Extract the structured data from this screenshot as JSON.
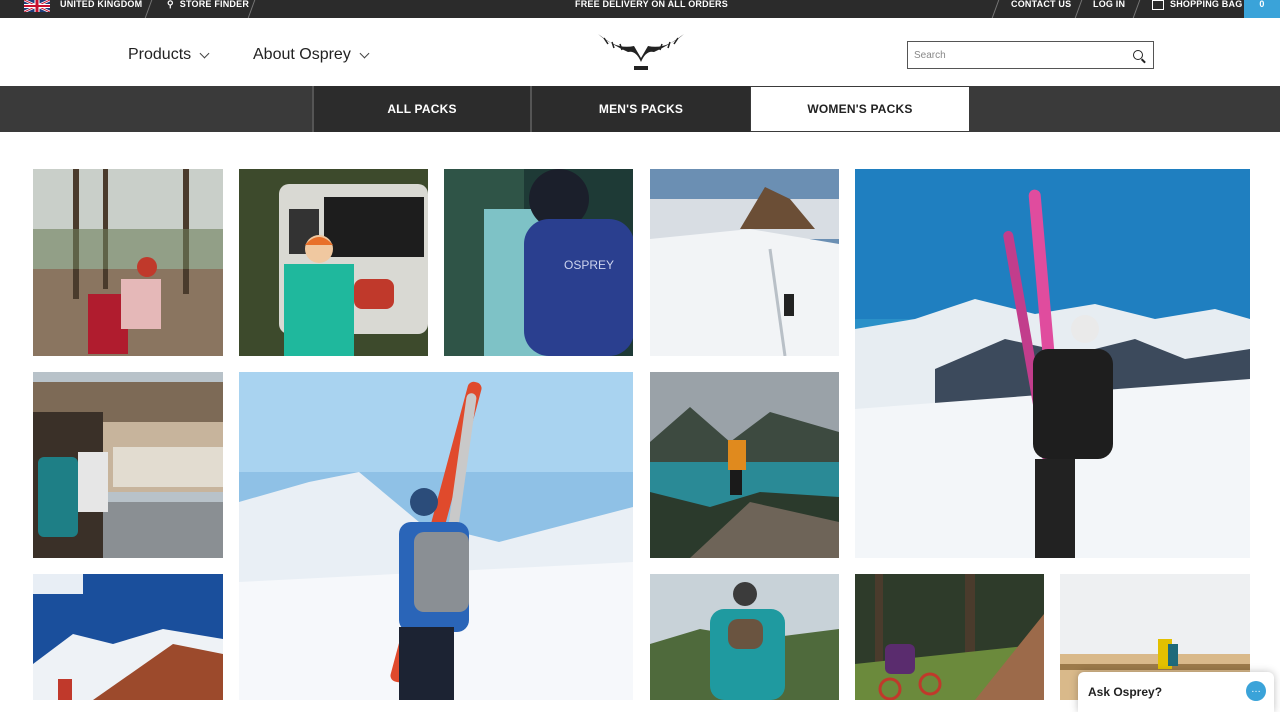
{
  "topbar": {
    "country": "UNITED KINGDOM",
    "store_finder": "STORE FINDER",
    "promo": "FREE DELIVERY ON ALL ORDERS",
    "contact": "CONTACT US",
    "login": "LOG IN",
    "bag": "SHOPPING BAG",
    "bag_count": "0"
  },
  "header": {
    "nav": [
      "Products",
      "About Osprey"
    ],
    "search_placeholder": "Search"
  },
  "tabs": [
    {
      "label": "ALL PACKS",
      "active": false
    },
    {
      "label": "MEN'S PACKS",
      "active": false
    },
    {
      "label": "WOMEN'S PACKS",
      "active": true
    }
  ],
  "gallery": {
    "images": [
      "hiker-forest-red-pack",
      "woman-jeep-orange-beanie",
      "blue-osprey-pack-closeup",
      "snow-mountain-hiker",
      "skier-pink-skis-summit",
      "woman-city-view-teal-pack",
      "skier-blue-jacket-snow",
      "lake-overlook-hiker",
      "mountain-peaks-red-hill",
      "teal-pack-dog",
      "mountain-biker-forest",
      "hiker-yellow-jacket-dunes"
    ]
  },
  "chat": {
    "label": "Ask Osprey?"
  },
  "colors": {
    "accent": "#3aa3d9",
    "bar": "#2b2b2b",
    "tabs": "#2c2c2c"
  }
}
